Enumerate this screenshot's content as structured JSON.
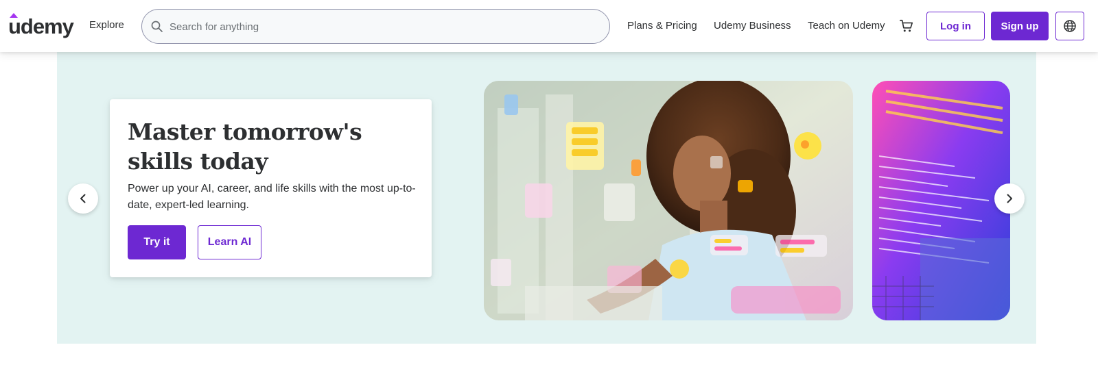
{
  "header": {
    "logo_text": "udemy",
    "explore_label": "Explore",
    "search": {
      "placeholder": "Search for anything",
      "value": ""
    },
    "links": [
      "Plans & Pricing",
      "Udemy Business",
      "Teach on Udemy"
    ],
    "login_label": "Log in",
    "signup_label": "Sign up",
    "icons": {
      "search": "search-icon",
      "cart": "cart-icon",
      "language": "globe-icon"
    }
  },
  "hero": {
    "title_line1": "Master tomorrow's",
    "title_line2": "skills today",
    "subtitle": "Power up your AI, career, and life skills with the most up-to-date, expert-led learning.",
    "primary_cta": "Try it",
    "secondary_cta": "Learn AI",
    "carousel": {
      "prev_icon": "chevron-left-icon",
      "next_icon": "chevron-right-icon"
    }
  },
  "colors": {
    "brand_purple": "#6d28d2",
    "hero_background": "#e3f3f2",
    "text_dark": "#2d2f31",
    "search_border": "#9194ac"
  }
}
